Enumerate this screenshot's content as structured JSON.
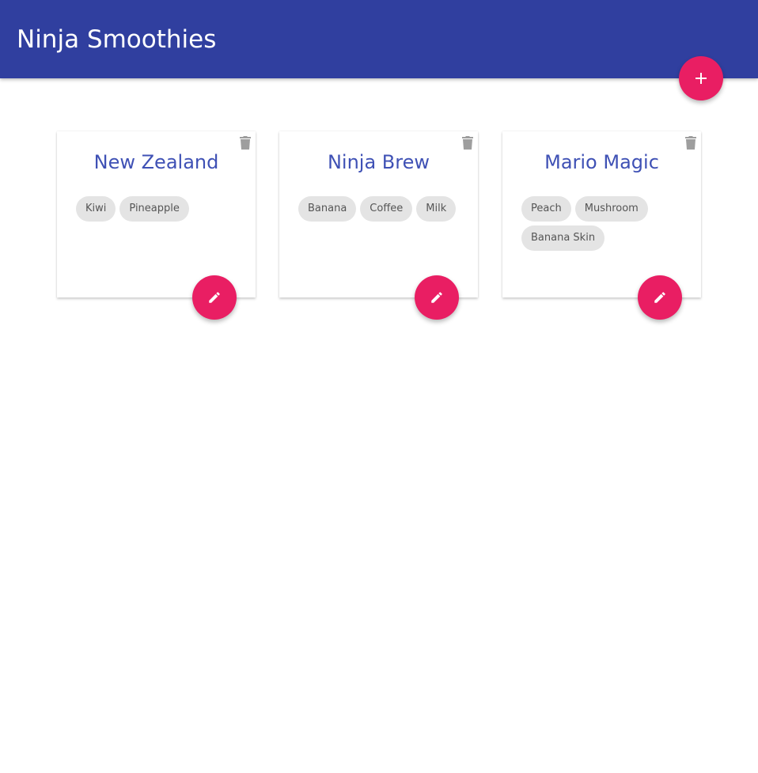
{
  "navbar": {
    "brand": "Ninja Smoothies",
    "color": "#303f9f"
  },
  "add_button": {
    "icon": "plus-icon",
    "color": "#e91e63"
  },
  "smoothies": [
    {
      "title": "New Zealand",
      "ingredients": [
        "Kiwi",
        "Pineapple"
      ]
    },
    {
      "title": "Ninja Brew",
      "ingredients": [
        "Banana",
        "Coffee",
        "Milk"
      ]
    },
    {
      "title": "Mario Magic",
      "ingredients": [
        "Peach",
        "Mushroom",
        "Banana Skin"
      ]
    }
  ],
  "card_icons": {
    "delete": "trash-icon",
    "edit": "pencil-icon"
  },
  "colors": {
    "title": "#3f51b5",
    "accent": "#e91e63",
    "chip_bg": "#e4e4e4"
  }
}
